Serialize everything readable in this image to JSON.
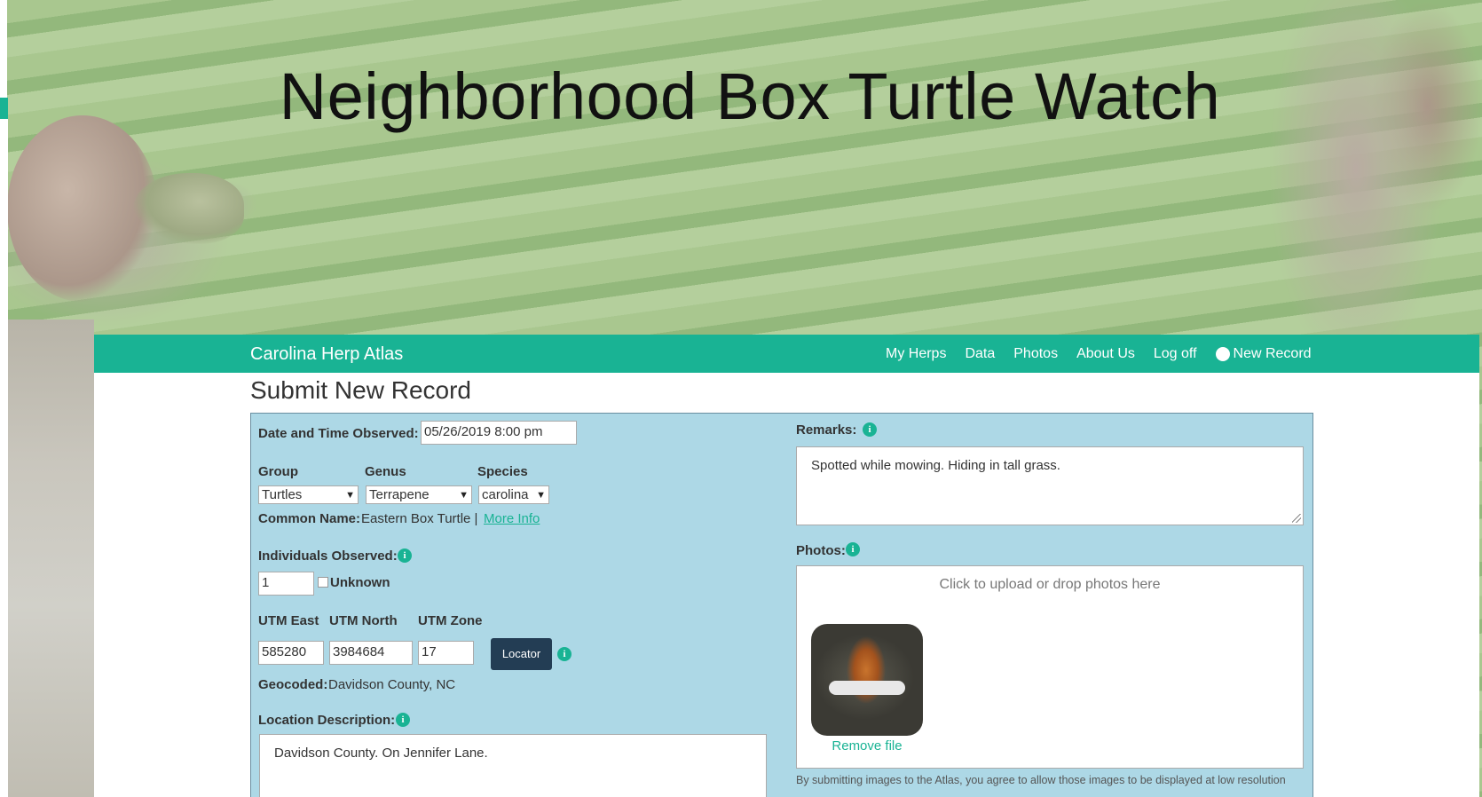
{
  "slide": {
    "title": "Neighborhood Box Turtle Watch"
  },
  "navbar": {
    "brand": "Carolina Herp Atlas",
    "links": [
      "My Herps",
      "Data",
      "Photos",
      "About Us",
      "Log off"
    ],
    "new_record": "New Record",
    "new_record_icon": "plus-circle-icon"
  },
  "page": {
    "heading": "Submit New Record"
  },
  "form": {
    "datetime_label": "Date and Time Observed:",
    "datetime_value": "05/26/2019 8:00 pm",
    "group_label": "Group",
    "genus_label": "Genus",
    "species_label": "Species",
    "group_value": "Turtles",
    "genus_value": "Terrapene",
    "species_value": "carolina",
    "common_name_label": "Common Name:",
    "common_name_value": "Eastern Box Turtle |",
    "more_info": "More Info",
    "individuals_label": "Individuals Observed:",
    "individuals_value": "1",
    "unknown_label": "Unknown",
    "utm_east_label": "UTM East",
    "utm_north_label": "UTM North",
    "utm_zone_label": "UTM Zone",
    "utm_east_value": "585280",
    "utm_north_value": "3984684",
    "utm_zone_value": "17",
    "locator_button": "Locator",
    "geocoded_label": "Geocoded:",
    "geocoded_value": "Davidson County, NC",
    "location_desc_label": "Location Description:",
    "location_desc_value": "Davidson County. On Jennifer Lane.",
    "remarks_label": "Remarks:",
    "remarks_value": "Spotted while mowing. Hiding in tall grass.",
    "photos_label": "Photos:",
    "dropzone_msg": "Click to upload or drop photos here",
    "remove_file": "Remove file",
    "disclaimer": "By submitting images to the Atlas, you agree to allow those images to be displayed at low resolution"
  },
  "colors": {
    "accent": "#19b394",
    "panel": "#add8e6",
    "button_dark": "#233d54"
  }
}
